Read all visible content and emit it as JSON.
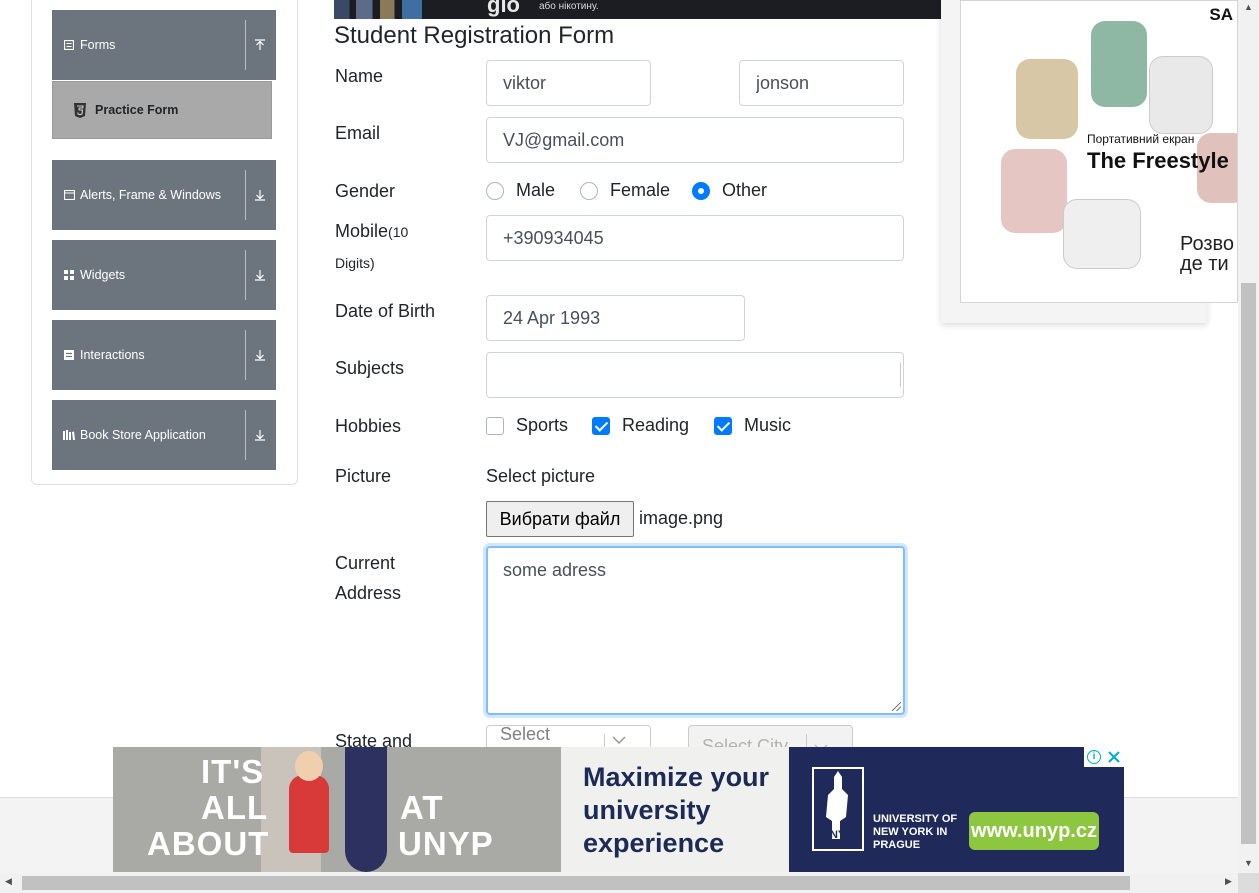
{
  "sidebar": {
    "forms": {
      "label": "Forms",
      "icon": "document-icon",
      "arrow": "collapse-up-icon"
    },
    "practice_form": {
      "label": "Practice Form",
      "icon": "html5-icon"
    },
    "groups": [
      {
        "label": "Alerts, Frame & Windows",
        "icon": "window-icon"
      },
      {
        "label": "Widgets",
        "icon": "grid-icon"
      },
      {
        "label": "Interactions",
        "icon": "list-icon"
      },
      {
        "label": "Book Store Application",
        "icon": "books-icon"
      }
    ]
  },
  "top_ad": {
    "brand": "glo",
    "tagline": "або нікотину."
  },
  "form": {
    "title": "Student Registration Form",
    "name_label": "Name",
    "first_name": "viktor",
    "last_name": "jonson",
    "email_label": "Email",
    "email": "VJ@gmail.com",
    "gender_label": "Gender",
    "genders": [
      {
        "label": "Male",
        "checked": false
      },
      {
        "label": "Female",
        "checked": false
      },
      {
        "label": "Other",
        "checked": true
      }
    ],
    "mobile_label": "Mobile",
    "mobile_hint": "(10",
    "mobile_hint2": "Digits)",
    "mobile": "+390934045",
    "dob_label": "Date of Birth",
    "dob": "24 Apr 1993",
    "subjects_label": "Subjects",
    "subjects": "",
    "hobbies_label": "Hobbies",
    "hobbies": [
      {
        "label": "Sports",
        "checked": false
      },
      {
        "label": "Reading",
        "checked": true
      },
      {
        "label": "Music",
        "checked": true
      }
    ],
    "picture_label": "Picture",
    "select_picture": "Select picture",
    "choose_file": "Вибрати файл",
    "file_name": "image.png",
    "address_label_1": "Current",
    "address_label_2": "Address",
    "address": "some adress",
    "state_city_label": "State and",
    "state_placeholder": "Select",
    "city_placeholder": "Select City"
  },
  "right_ad": {
    "brand": "SA",
    "ua_line": "Портативний екран",
    "product": "The Freestyle",
    "ua_bottom_1": "Розво",
    "ua_bottom_2": "де ти"
  },
  "bottom_ad": {
    "left_1": "IT'S",
    "left_2": "ALL",
    "left_3": "ABOUT",
    "left_4": "AT",
    "left_5": "UNYP",
    "middle": "Maximize your university experience",
    "university": "UNIVERSITY OF NEW YORK IN PRAGUE",
    "logo_text": "UNYP",
    "url": "www.unyp.cz"
  },
  "colors": {
    "sidebar": "#6c757d",
    "active_item": "#a9a9a9",
    "accent": "#007bff",
    "focus": "#80bdff"
  }
}
